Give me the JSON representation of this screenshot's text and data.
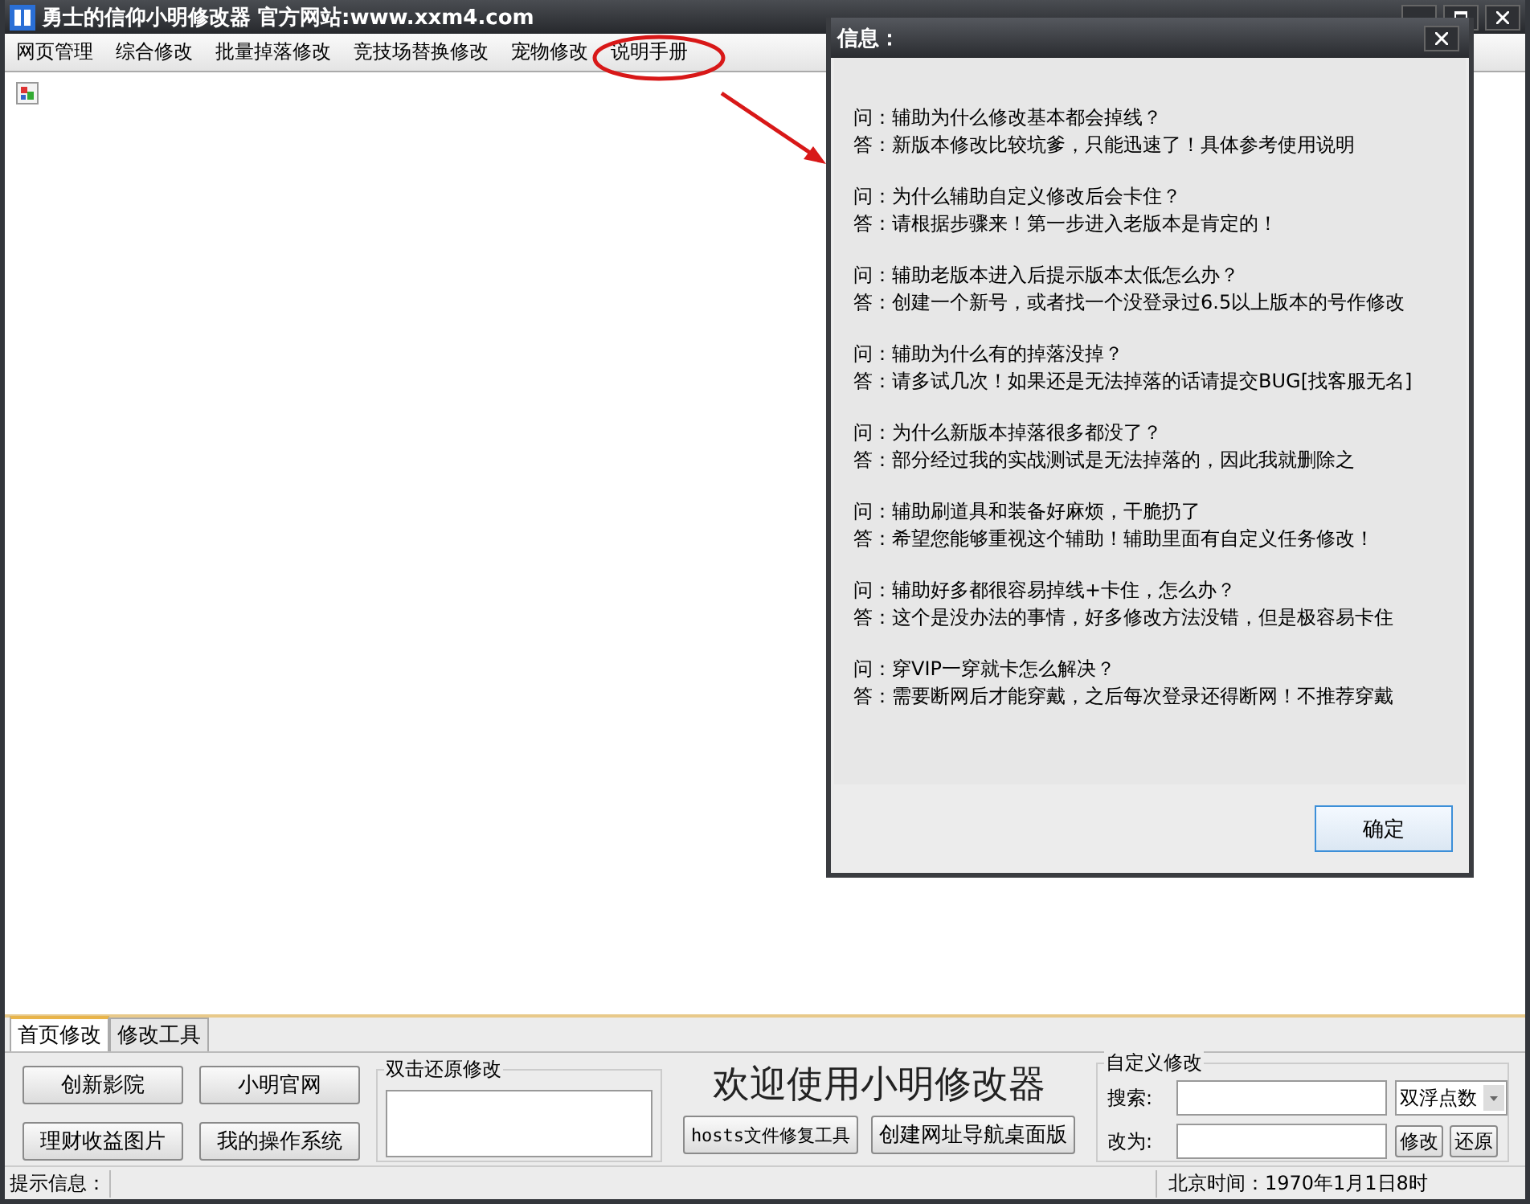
{
  "window": {
    "title": "勇士的信仰小明修改器 官方网站:www.xxm4.com"
  },
  "menu": [
    {
      "label": "网页管理"
    },
    {
      "label": "综合修改"
    },
    {
      "label": "批量掉落修改"
    },
    {
      "label": "竞技场替换修改"
    },
    {
      "label": "宠物修改"
    },
    {
      "label": "说明手册"
    }
  ],
  "tabs": [
    {
      "label": "首页修改",
      "selected": true
    },
    {
      "label": "修改工具",
      "selected": false
    }
  ],
  "panel": {
    "buttons": [
      "创新影院",
      "小明官网",
      "理财收益图片",
      "我的操作系统"
    ],
    "restore_group": {
      "title": "双击还原修改"
    },
    "welcome": "欢迎使用小明修改器",
    "tool_buttons": [
      "hosts文件修复工具",
      "创建网址导航桌面版"
    ],
    "custom_group": {
      "title": "自定义修改",
      "search_label": "搜索:",
      "type_value": "双浮点数",
      "replace_label": "改为:",
      "modify_button": "修改",
      "restore_button": "还原"
    }
  },
  "status_bar": {
    "hint_label": "提示信息：",
    "time": "北京时间：1970年1月1日8时"
  },
  "dialog": {
    "title": "信息：",
    "items": [
      {
        "q": "问：辅助为什么修改基本都会掉线？",
        "a": "答：新版本修改比较坑爹，只能迅速了！具体参考使用说明"
      },
      {
        "q": "问：为什么辅助自定义修改后会卡住？",
        "a": "答：请根据步骤来！第一步进入老版本是肯定的！"
      },
      {
        "q": "问：辅助老版本进入后提示版本太低怎么办？",
        "a": "答：创建一个新号，或者找一个没登录过6.5以上版本的号作修改"
      },
      {
        "q": "问：辅助为什么有的掉落没掉？",
        "a": "答：请多试几次！如果还是无法掉落的话请提交BUG[找客服无名]"
      },
      {
        "q": "问：为什么新版本掉落很多都没了？",
        "a": "答：部分经过我的实战测试是无法掉落的，因此我就删除之"
      },
      {
        "q": "问：辅助刷道具和装备好麻烦，干脆扔了",
        "a": "答：希望您能够重视这个辅助！辅助里面有自定义任务修改！"
      },
      {
        "q": "问：辅助好多都很容易掉线+卡住，怎么办？",
        "a": "答：这个是没办法的事情，好多修改方法没错，但是极容易卡住"
      },
      {
        "q": "问：穿VIP一穿就卡怎么解决？",
        "a": "答：需要断网后才能穿戴，之后每次登录还得断网！不推荐穿戴"
      }
    ],
    "ok_button": "确定"
  }
}
